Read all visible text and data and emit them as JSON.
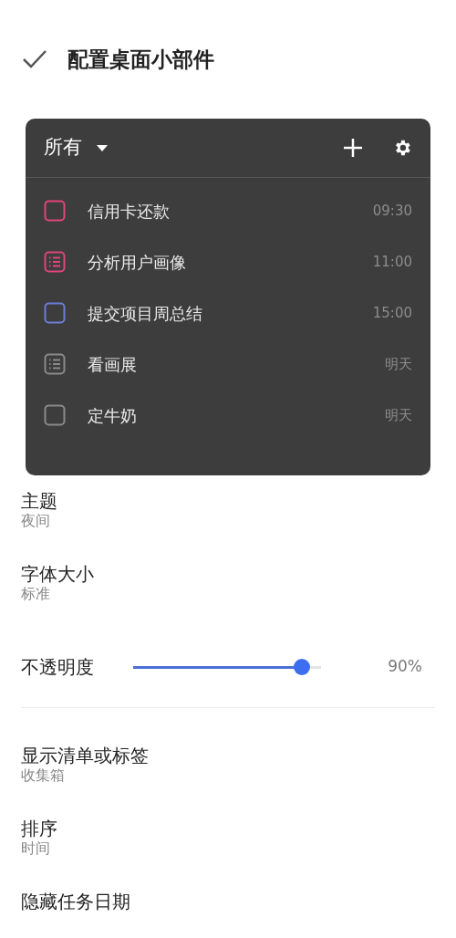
{
  "header": {
    "title": "配置桌面小部件"
  },
  "widget": {
    "filter": "所有",
    "tasks": [
      {
        "title": "信用卡还款",
        "time": "09:30",
        "kind": "checkbox",
        "color": "#e0457b"
      },
      {
        "title": "分析用户画像",
        "time": "11:00",
        "kind": "note",
        "color": "#e0457b"
      },
      {
        "title": "提交项目周总结",
        "time": "15:00",
        "kind": "checkbox",
        "color": "#6b7fd7"
      },
      {
        "title": "看画展",
        "time": "明天",
        "kind": "note",
        "color": "#8a8a8a"
      },
      {
        "title": "定牛奶",
        "time": "明天",
        "kind": "checkbox",
        "color": "#8a8a8a"
      }
    ]
  },
  "settings": [
    {
      "kind": "option",
      "label": "主题",
      "value": "夜间"
    },
    {
      "kind": "option",
      "label": "字体大小",
      "value": "标准"
    },
    {
      "kind": "slider",
      "label": "不透明度",
      "level": 0.9,
      "reading": "90%"
    },
    {
      "kind": "divider"
    },
    {
      "kind": "option",
      "label": "显示清单或标签",
      "value": "收集箱"
    },
    {
      "kind": "option",
      "label": "排序",
      "value": "时间"
    },
    {
      "kind": "option",
      "label": "隐藏任务日期"
    }
  ]
}
